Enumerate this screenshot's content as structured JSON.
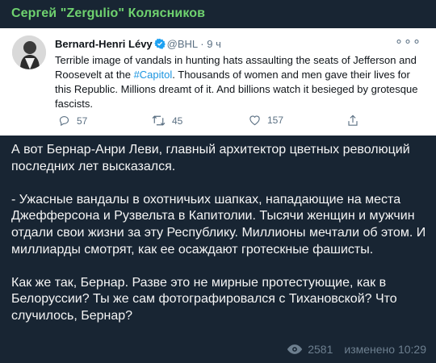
{
  "channel": {
    "author_name": "Сергей \"Zergulio\" Колясников"
  },
  "tweet": {
    "name": "Bernard-Henri Lévy",
    "handle": "@BHL",
    "time": "· 9 ч",
    "text_before": "Terrible image of vandals in hunting hats assaulting the seats of Jefferson and Roosevelt at the ",
    "hashtag": "#Capitol",
    "text_after": ". Thousands of women and men gave their lives for this Republic. Millions dreamt of it. And billions watch it besieged by grotesque fascists.",
    "replies": "57",
    "retweets": "45",
    "likes": "157"
  },
  "message": {
    "paragraph1": "А вот Бернар-Анри Леви, главный архитектор цветных революций последних лет высказался.",
    "paragraph2": "- Ужасные вандалы в охотничьих шапках, нападающие на места Джефферсона и Рузвельта в Капитолии. Тысячи женщин и мужчин отдали свои жизни за эту Республику. Миллионы мечтали об этом. И миллиарды смотрят, как ее осаждают гротескные фашисты.",
    "paragraph3": "Как же так, Бернар. Разве это не мирные протестующие, как в Белоруссии? Ты же сам фотографировался с Тихановской? Что случилось, Бернар?"
  },
  "footer": {
    "views": "2581",
    "edited_time": "изменено 10:29"
  },
  "colors": {
    "author": "#6fd26f",
    "hashtag": "#1b95e0",
    "background": "#182533"
  }
}
